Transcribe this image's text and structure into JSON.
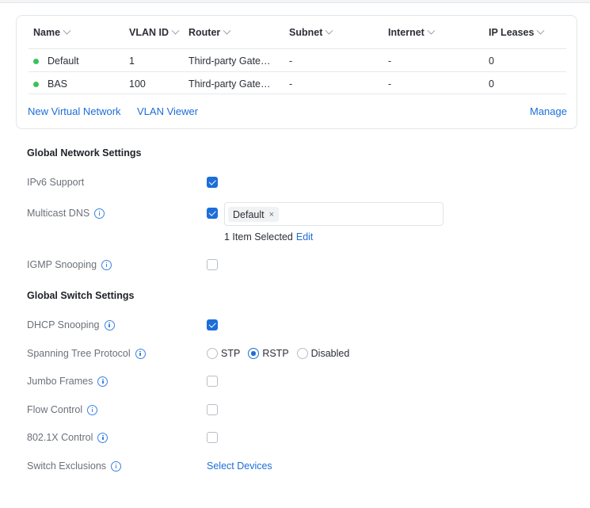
{
  "table": {
    "columns": [
      "Name",
      "VLAN ID",
      "Router",
      "Subnet",
      "Internet",
      "IP Leases"
    ],
    "rows": [
      {
        "name": "Default",
        "vlan_id": "1",
        "router": "Third-party Gate…",
        "subnet": "-",
        "internet": "-",
        "ip_leases": "0",
        "status_color": "#38c35b"
      },
      {
        "name": "BAS",
        "vlan_id": "100",
        "router": "Third-party Gate…",
        "subnet": "-",
        "internet": "-",
        "ip_leases": "0",
        "status_color": "#38c35b"
      }
    ],
    "new_network_link": "New Virtual Network",
    "vlan_viewer_link": "VLAN Viewer",
    "manage_link": "Manage"
  },
  "global_network": {
    "title": "Global Network Settings",
    "ipv6_label": "IPv6 Support",
    "ipv6_checked": true,
    "mdns_label": "Multicast DNS",
    "mdns_checked": true,
    "mdns_tag": "Default",
    "mdns_tag_remove": "×",
    "mdns_selected": "1 Item Selected",
    "mdns_edit": "Edit",
    "igmp_label": "IGMP Snooping",
    "igmp_checked": false
  },
  "global_switch": {
    "title": "Global Switch Settings",
    "dhcp_label": "DHCP Snooping",
    "dhcp_checked": true,
    "stp_label": "Spanning Tree Protocol",
    "stp_options": [
      "STP",
      "RSTP",
      "Disabled"
    ],
    "stp_selected": "RSTP",
    "jumbo_label": "Jumbo Frames",
    "jumbo_checked": false,
    "flow_label": "Flow Control",
    "flow_checked": false,
    "dot1x_label": "802.1X Control",
    "dot1x_checked": false,
    "exclusions_label": "Switch Exclusions",
    "exclusions_link": "Select Devices"
  },
  "colors": {
    "accent": "#1c6ed9",
    "status_online": "#38c35b"
  }
}
